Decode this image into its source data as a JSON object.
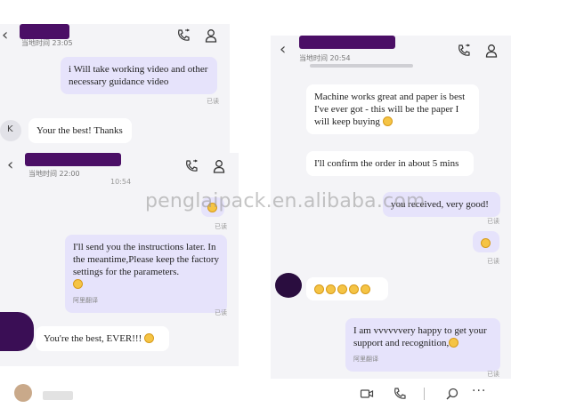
{
  "panel_a": {
    "time": "当地时间 23:05",
    "msg1": "i Will take working video and other necessary guidance video",
    "read1": "已读",
    "contact_initial": "K",
    "msg2": "Your the best! Thanks"
  },
  "panel_b": {
    "time": "当地时间 22:00",
    "stamp": "10:54",
    "read1": "已读",
    "msg1": "I'll send you the instructions later. In the meantime,Please keep the factory settings for the parameters.",
    "translate": "阿里翻译",
    "read2": "已读",
    "msg2": "You're the best, EVER!!!"
  },
  "panel_c": {
    "time": "当地时间 20:54",
    "msg1": "Machine works great and paper is best I've ever got - this will be the paper I will keep buying",
    "msg2": "I'll confirm the order in about 5 mins",
    "msg3": "you received, very good!",
    "read1": "已读",
    "read2": "已读",
    "msg5": "I am vvvvvvery happy to get your support and recognition,",
    "translate": "阿里翻译",
    "read3": "已读"
  },
  "watermark": "penglaipack.en.alibaba.com",
  "icons": {
    "call": "phone-icon",
    "profile": "person-icon",
    "video": "video-camera-icon",
    "search": "search-icon",
    "more": "more-dots-icon"
  },
  "colors": {
    "my_bubble": "#e6e3fb",
    "their_bubble": "#ffffff",
    "chat_bg": "#f4f4f7",
    "redaction": "#4b0f66"
  }
}
